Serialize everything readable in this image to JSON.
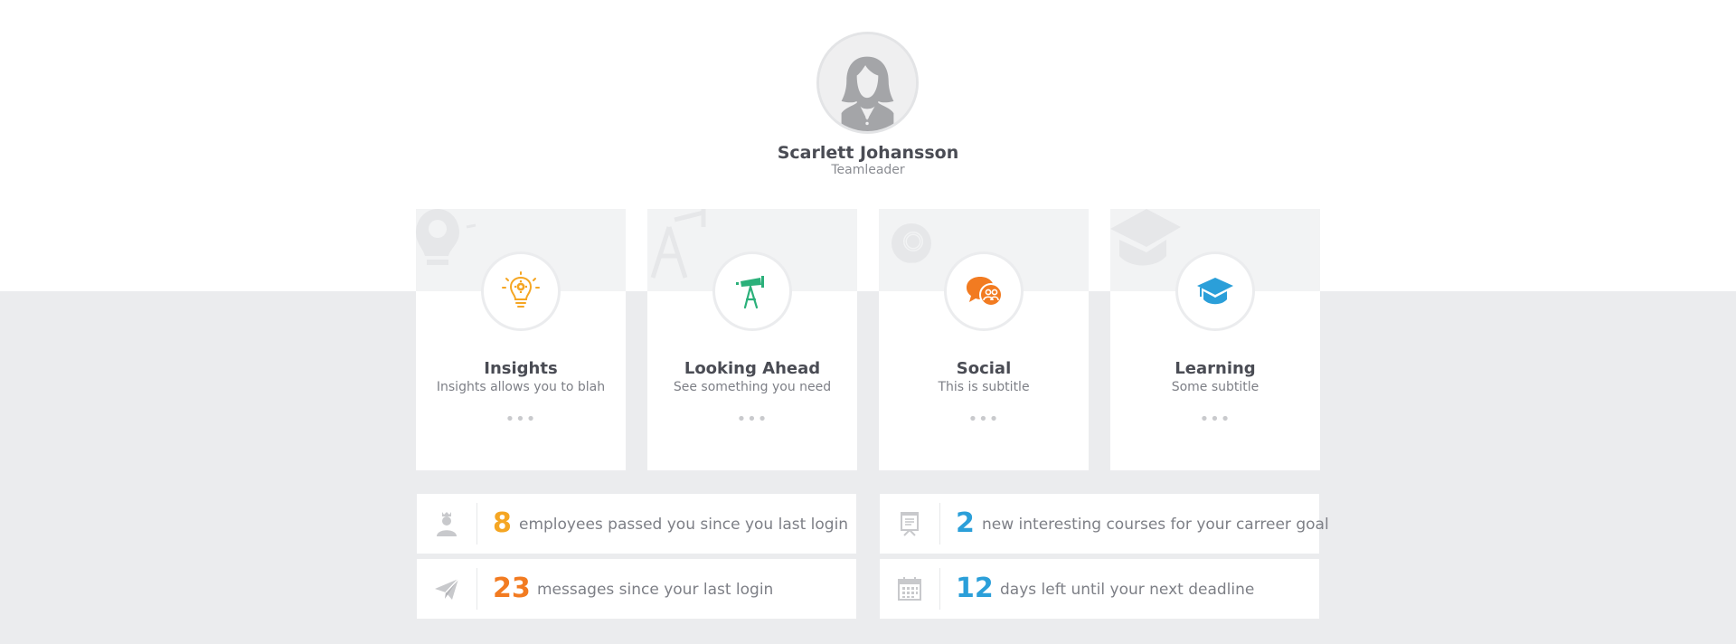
{
  "profile": {
    "name": "Scarlett Johansson",
    "role": "Teamleader"
  },
  "cards": [
    {
      "title": "Insights",
      "subtitle": "Insights allows you to blah",
      "more": "•••",
      "icon": "lightbulb-icon",
      "color": "#f5a623"
    },
    {
      "title": "Looking Ahead",
      "subtitle": "See something you need",
      "more": "•••",
      "icon": "telescope-icon",
      "color": "#2bb07a"
    },
    {
      "title": "Social",
      "subtitle": "This is subtitle",
      "more": "•••",
      "icon": "chat-people-icon",
      "color": "#f27b21"
    },
    {
      "title": "Learning",
      "subtitle": "Some subtitle",
      "more": "•••",
      "icon": "graduation-cap-icon",
      "color": "#2b9fd9"
    }
  ],
  "stats": [
    {
      "number": "8",
      "text": "employees passed you since you last login",
      "icon": "crowned-person-icon",
      "color": "#f5a623"
    },
    {
      "number": "2",
      "text": "new interesting courses for your carreer goal",
      "icon": "presentation-board-icon",
      "color": "#2b9fd9"
    },
    {
      "number": "23",
      "text": "messages since your last login",
      "icon": "paper-plane-icon",
      "color": "#f27b21"
    },
    {
      "number": "12",
      "text": "days left until your next deadline",
      "icon": "calendar-icon",
      "color": "#2b9fd9"
    }
  ]
}
